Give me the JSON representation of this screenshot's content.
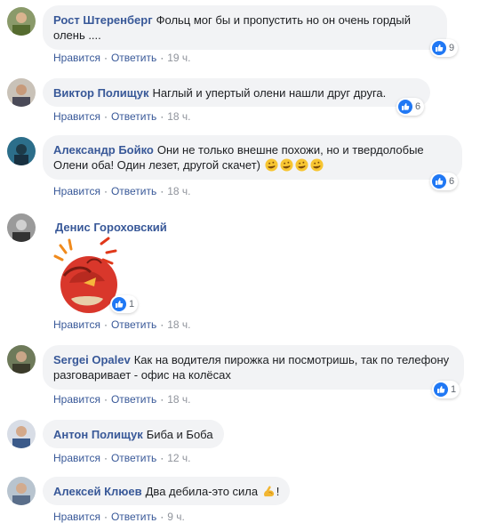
{
  "actions": {
    "like": "Нравится",
    "reply": "Ответить"
  },
  "comments": [
    {
      "author": "Рост Штеренберг",
      "text": "Фольц мог бы и пропустить но он очень гордый олень ....",
      "likes": "9",
      "time": "19 ч."
    },
    {
      "author": "Виктор Полищук",
      "text": "Наглый и упертый олени нашли друг друга.",
      "likes": "6",
      "time": "18 ч."
    },
    {
      "author": "Александр Бойко",
      "text": "Они не только внешне похожи, но и твердолобые Олени оба! Один лезет, другой скачет)",
      "likes": "6",
      "time": "18 ч.",
      "emojis": [
        "rofl-emoji",
        "rofl-emoji",
        "rofl-emoji",
        "rofl-emoji"
      ]
    },
    {
      "author": "Денис Гороховский",
      "likes": "1",
      "time": "18 ч.",
      "sticker": "angry-bird-sticker"
    },
    {
      "author": "Sergei Opalev",
      "text": "Как на водителя пирожка ни посмотришь, так по телефону разговаривает - офис на колёсах",
      "likes": "1",
      "time": "18 ч."
    },
    {
      "author": "Антон Полищук",
      "text": "Биба и Боба",
      "time": "12 ч."
    },
    {
      "author": "Алексей Клюев",
      "text": "Два дебила-это сила",
      "text_end": "!",
      "time": "9 ч.",
      "emojis": [
        "flexed-biceps-emoji"
      ]
    }
  ],
  "colors": {
    "link": "#385898",
    "bubble": "#f2f3f5",
    "like_blue": "#2078f4"
  }
}
